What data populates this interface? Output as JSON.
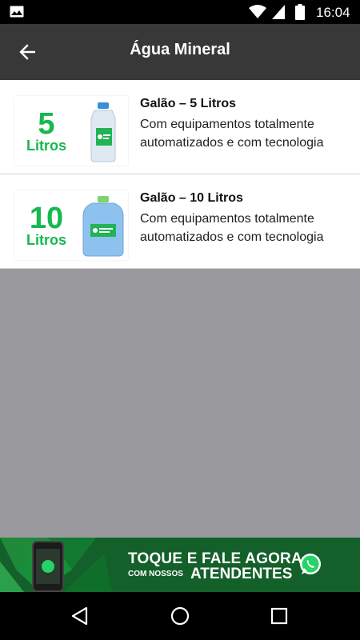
{
  "status_bar": {
    "time": "16:04",
    "icons": [
      "image-icon",
      "wifi-icon",
      "signal-icon",
      "battery-icon"
    ]
  },
  "app_bar": {
    "title": "Água Mineral",
    "back_icon": "arrow-back-icon"
  },
  "products": [
    {
      "thumb_number": "5",
      "thumb_unit": "Litros",
      "title": "Galão – 5 Litros",
      "description": "Com equipamentos totalmente automatizados e com tecnologia"
    },
    {
      "thumb_number": "10",
      "thumb_unit": "Litros",
      "title": "Galão – 10 Litros",
      "description": "Com equipamentos totalmente automatizados e com tecnologia"
    }
  ],
  "banner": {
    "line1": "TOQUE E FALE AGORA",
    "line2_small": "COM NOSSOS",
    "line2_big": "ATENDENTES",
    "icon": "whatsapp-icon"
  },
  "nav_bar": {
    "buttons": [
      "back-triangle-icon",
      "home-circle-icon",
      "recents-square-icon"
    ]
  },
  "colors": {
    "app_bar": "#383838",
    "accent_green": "#16b84f",
    "banner_green": "#15632b",
    "background": "#9a9a9e"
  }
}
